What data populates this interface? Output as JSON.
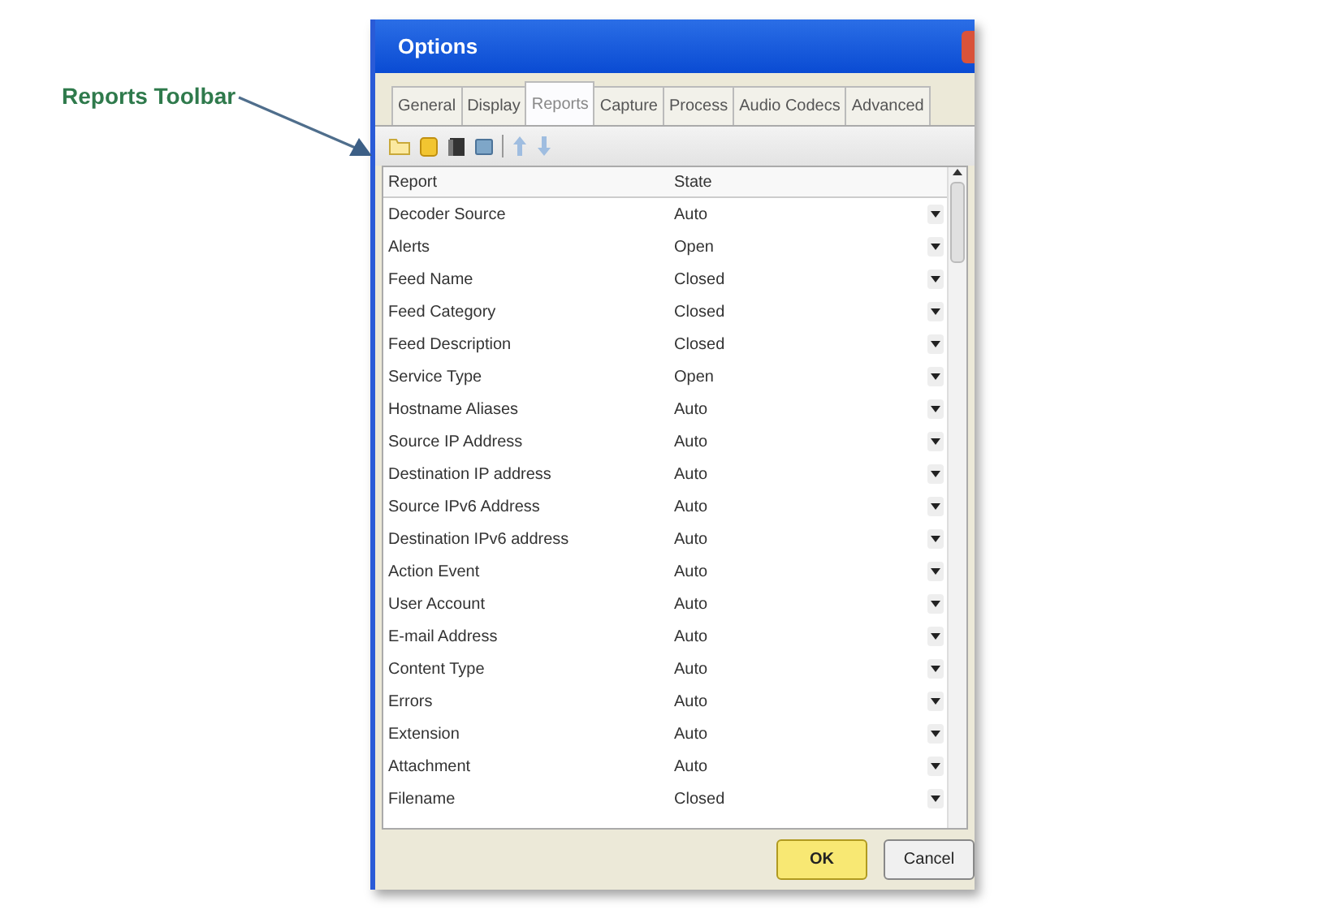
{
  "annotation": {
    "label": "Reports Toolbar"
  },
  "window": {
    "title": "Options"
  },
  "tabs": [
    {
      "label": "General",
      "selected": false
    },
    {
      "label": "Display",
      "selected": false
    },
    {
      "label": "Reports",
      "selected": true
    },
    {
      "label": "Capture",
      "selected": false
    },
    {
      "label": "Process",
      "selected": false
    },
    {
      "label": "Audio Codecs",
      "selected": false
    },
    {
      "label": "Advanced",
      "selected": false
    }
  ],
  "table": {
    "columns": [
      "Report",
      "State"
    ],
    "rows": [
      {
        "report": "Decoder Source",
        "state": "Auto"
      },
      {
        "report": "Alerts",
        "state": "Open"
      },
      {
        "report": "Feed Name",
        "state": "Closed"
      },
      {
        "report": "Feed Category",
        "state": "Closed"
      },
      {
        "report": "Feed Description",
        "state": "Closed"
      },
      {
        "report": "Service Type",
        "state": "Open"
      },
      {
        "report": "Hostname Aliases",
        "state": "Auto"
      },
      {
        "report": "Source IP Address",
        "state": "Auto"
      },
      {
        "report": "Destination IP address",
        "state": "Auto"
      },
      {
        "report": "Source IPv6 Address",
        "state": "Auto"
      },
      {
        "report": "Destination IPv6 address",
        "state": "Auto"
      },
      {
        "report": "Action Event",
        "state": "Auto"
      },
      {
        "report": "User Account",
        "state": "Auto"
      },
      {
        "report": "E-mail Address",
        "state": "Auto"
      },
      {
        "report": "Content Type",
        "state": "Auto"
      },
      {
        "report": "Errors",
        "state": "Auto"
      },
      {
        "report": "Extension",
        "state": "Auto"
      },
      {
        "report": "Attachment",
        "state": "Auto"
      },
      {
        "report": "Filename",
        "state": "Closed"
      }
    ]
  },
  "buttons": [
    {
      "label": "OK",
      "default": true
    },
    {
      "label": "Cancel",
      "default": false
    }
  ]
}
